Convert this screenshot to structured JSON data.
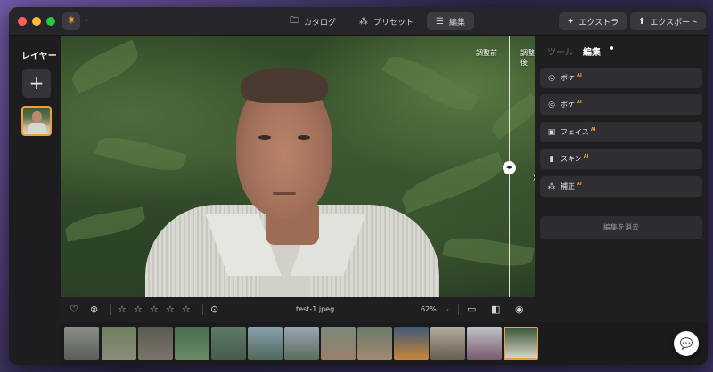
{
  "titlebar": {
    "tabs": [
      {
        "label": "カタログ",
        "icon": "folder-icon"
      },
      {
        "label": "プリセット",
        "icon": "magic-wand-icon"
      },
      {
        "label": "編集",
        "icon": "sliders-icon",
        "active": true
      }
    ],
    "extra_label": "エクストラ",
    "export_label": "エクスポート"
  },
  "sidebar": {
    "title": "レイヤー"
  },
  "photo": {
    "before_label": "調整前",
    "after_label": "調整後"
  },
  "right_panel": {
    "tab_tools": "ツール",
    "tab_edit": "編集",
    "items": [
      {
        "label": "ボケ",
        "badge": "AI",
        "icon": "aperture-icon"
      },
      {
        "label": "ボケ",
        "badge": "AI",
        "icon": "aperture-icon"
      },
      {
        "label": "フェイス",
        "badge": "AI",
        "icon": "face-portrait-icon"
      },
      {
        "label": "スキン",
        "badge": "AI",
        "icon": "bottle-icon"
      },
      {
        "label": "補正",
        "badge": "AI",
        "icon": "sparkle-wand-icon"
      }
    ],
    "clear_label": "編集を消去"
  },
  "bottom_bar": {
    "file_name": "test-1.jpeg",
    "zoom": "62%",
    "rating_max": 5
  },
  "colors": {
    "accent": "#e8a23a",
    "ai_badge": "#f0a030",
    "window_bg": "#1f1f22"
  }
}
